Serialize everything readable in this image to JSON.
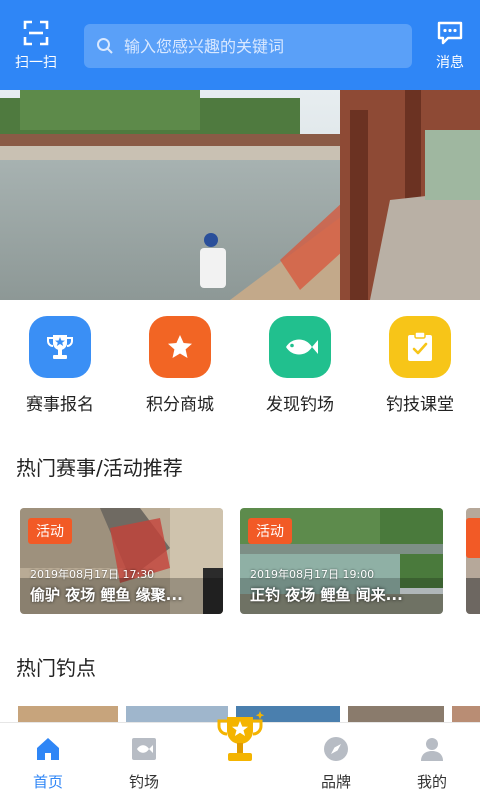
{
  "header": {
    "scan_label": "扫一扫",
    "search_placeholder": "输入您感兴趣的关键词",
    "message_label": "消息"
  },
  "colors": {
    "brand": "#2f86f6",
    "tag": "#f25a26",
    "gold": "#f4b400"
  },
  "quick_links": [
    {
      "label": "赛事报名",
      "icon": "trophy-icon",
      "color": "#3a8ff5"
    },
    {
      "label": "积分商城",
      "icon": "star-icon",
      "color": "#f26524"
    },
    {
      "label": "发现钓场",
      "icon": "fish-icon",
      "color": "#21c08e"
    },
    {
      "label": "钓技课堂",
      "icon": "clipboard-check-icon",
      "color": "#f7c518"
    }
  ],
  "sections": {
    "events_title": "热门赛事/活动推荐",
    "spots_title": "热门钓点"
  },
  "events": [
    {
      "tag": "活动",
      "date": "2019年08月17日 17:30",
      "title": "偷驴 夜场 鲤鱼 缘聚..."
    },
    {
      "tag": "活动",
      "date": "2019年08月17日 19:00",
      "title": "正钓 夜场 鲤鱼 闻来..."
    }
  ],
  "tabs": [
    {
      "label": "首页",
      "icon": "home-icon"
    },
    {
      "label": "钓场",
      "icon": "fish-spot-icon"
    },
    {
      "label": "",
      "icon": "trophy-icon"
    },
    {
      "label": "品牌",
      "icon": "compass-icon"
    },
    {
      "label": "我的",
      "icon": "user-icon"
    }
  ]
}
